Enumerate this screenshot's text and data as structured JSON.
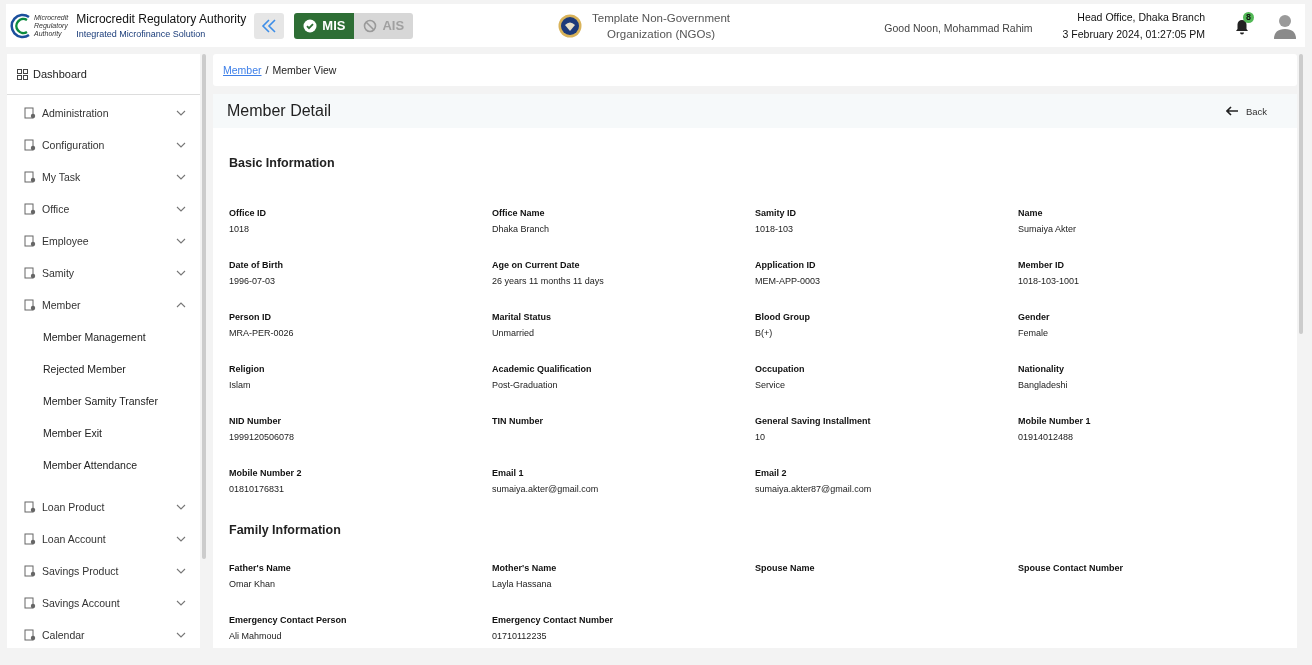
{
  "header": {
    "org_name": "Microcredit Regulatory Authority",
    "org_subtitle": "Integrated Microfinance Solution",
    "logo_text": [
      "Microcredit",
      "Regulatory",
      "Authority"
    ],
    "modules": [
      {
        "label": "MIS",
        "selected": true
      },
      {
        "label": "AIS",
        "selected": false
      }
    ],
    "ngo_name": [
      "Template Non-Government",
      "Organization (NGOs)"
    ],
    "greeting": "Good Noon, Mohammad Rahim",
    "branch": "Head Office, Dhaka Branch",
    "datetime": "3 February 2024, 01:27:05 PM",
    "notification_count": "8"
  },
  "sidebar": {
    "dashboard": "Dashboard",
    "items": [
      {
        "label": "Administration",
        "expanded": false
      },
      {
        "label": "Configuration",
        "expanded": false
      },
      {
        "label": "My Task",
        "expanded": false
      },
      {
        "label": "Office",
        "expanded": false
      },
      {
        "label": "Employee",
        "expanded": false
      },
      {
        "label": "Samity",
        "expanded": false
      },
      {
        "label": "Member",
        "expanded": true,
        "children": [
          {
            "label": "Member Management"
          },
          {
            "label": "Rejected Member"
          },
          {
            "label": "Member Samity Transfer"
          },
          {
            "label": "Member Exit"
          },
          {
            "label": "Member Attendance"
          }
        ]
      },
      {
        "label": "Loan Product",
        "expanded": false
      },
      {
        "label": "Loan Account",
        "expanded": false
      },
      {
        "label": "Savings Product",
        "expanded": false
      },
      {
        "label": "Savings Account",
        "expanded": false
      },
      {
        "label": "Calendar",
        "expanded": false
      }
    ]
  },
  "breadcrumb": {
    "link": "Member",
    "separator": "/",
    "current": "Member View"
  },
  "page": {
    "title": "Member Detail",
    "back": "Back",
    "sections": [
      {
        "title": "Basic Information",
        "fields": [
          {
            "label": "Office ID",
            "value": "1018"
          },
          {
            "label": "Office Name",
            "value": "Dhaka Branch"
          },
          {
            "label": "Samity ID",
            "value": "1018-103"
          },
          {
            "label": "Name",
            "value": "Sumaiya Akter"
          },
          {
            "label": "Date of Birth",
            "value": "1996-07-03"
          },
          {
            "label": "Age on Current Date",
            "value": "26 years 11 months 11 days"
          },
          {
            "label": "Application ID",
            "value": "MEM-APP-0003"
          },
          {
            "label": "Member ID",
            "value": "1018-103-1001"
          },
          {
            "label": "Person ID",
            "value": "MRA-PER-0026"
          },
          {
            "label": "Marital Status",
            "value": "Unmarried"
          },
          {
            "label": "Blood Group",
            "value": "B(+)"
          },
          {
            "label": "Gender",
            "value": "Female"
          },
          {
            "label": "Religion",
            "value": "Islam"
          },
          {
            "label": "Academic Qualification",
            "value": "Post-Graduation"
          },
          {
            "label": "Occupation",
            "value": "Service"
          },
          {
            "label": "Nationality",
            "value": "Bangladeshi"
          },
          {
            "label": "NID Number",
            "value": "1999120506078"
          },
          {
            "label": "TIN Number"
          },
          {
            "label": "General Saving Installment",
            "value": "10"
          },
          {
            "label": "Mobile Number 1",
            "value": "01914012488"
          },
          {
            "label": "Mobile Number 2",
            "value": "01810176831"
          },
          {
            "label": "Email 1",
            "value": "sumaiya.akter@gmail.com"
          },
          {
            "label": "Email 2",
            "value": "sumaiya.akter87@gmail.com"
          }
        ]
      },
      {
        "title": "Family Information",
        "fields": [
          {
            "label": "Father's Name",
            "value": "Omar Khan"
          },
          {
            "label": "Mother's Name",
            "value": "Layla Hassana"
          },
          {
            "label": "Spouse Name"
          },
          {
            "label": "Spouse Contact Number"
          },
          {
            "label": "Emergency Contact Person",
            "value": "Ali Mahmoud"
          },
          {
            "label": "Emergency Contact Number",
            "value": "01710112235"
          }
        ]
      }
    ]
  }
}
